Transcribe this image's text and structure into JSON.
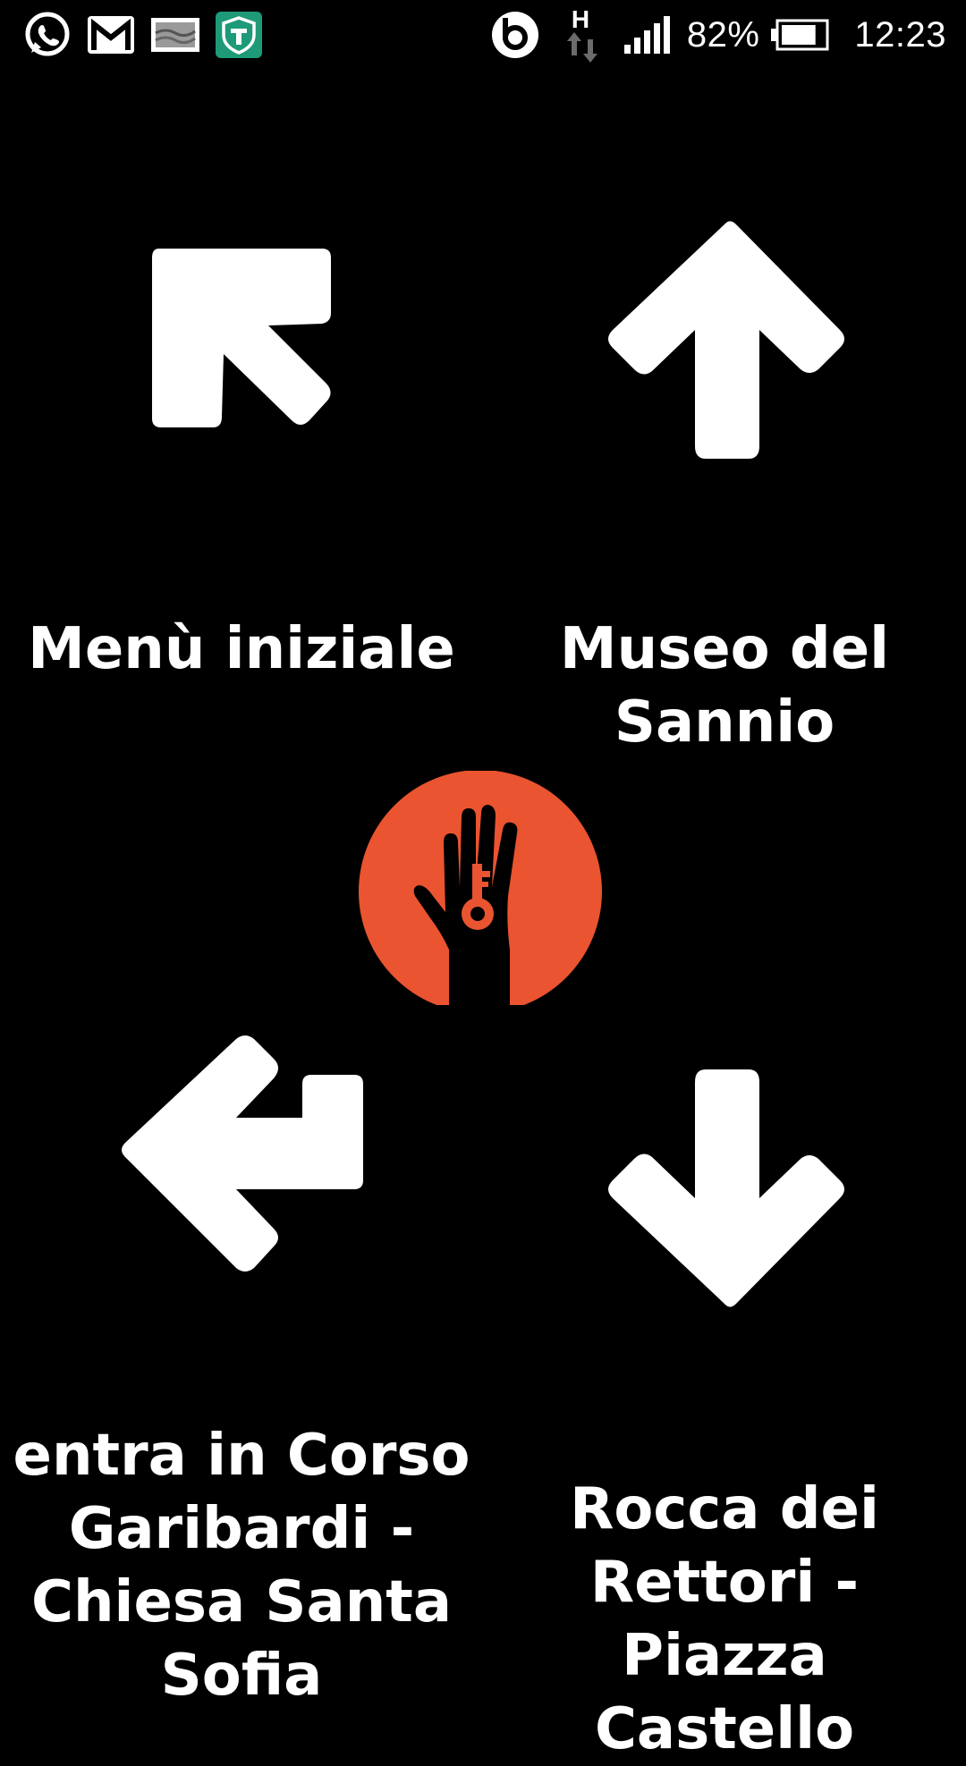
{
  "status_bar": {
    "left_icons": [
      "whatsapp-icon",
      "gmail-icon",
      "gallery-notification-icon",
      "shield-app-icon"
    ],
    "right_icons": [
      "beats-audio-icon",
      "h-network-data-icon",
      "signal-strength-icon",
      "battery-icon"
    ],
    "network_type": "H",
    "battery_percent": "82%",
    "battery_level": 0.82,
    "time": "12:23"
  },
  "navigation": {
    "top_left": {
      "label": "Menù iniziale",
      "icon": "arrow-up-left-icon"
    },
    "top_right": {
      "label": "Museo del\nSannio",
      "icon": "arrow-up-icon"
    },
    "bottom_left": {
      "label": "entra in Corso\nGaribardi -\nChiesa Santa\nSofia",
      "icon": "arrow-turn-left-icon"
    },
    "bottom_right": {
      "label": "Rocca dei\nRettori - Piazza\nCastello",
      "icon": "arrow-down-icon"
    }
  },
  "logo": {
    "icon": "hand-key-logo-icon",
    "color": "#ea5430"
  },
  "colors": {
    "background": "#000000",
    "foreground": "#ffffff",
    "accent": "#ea5430"
  }
}
